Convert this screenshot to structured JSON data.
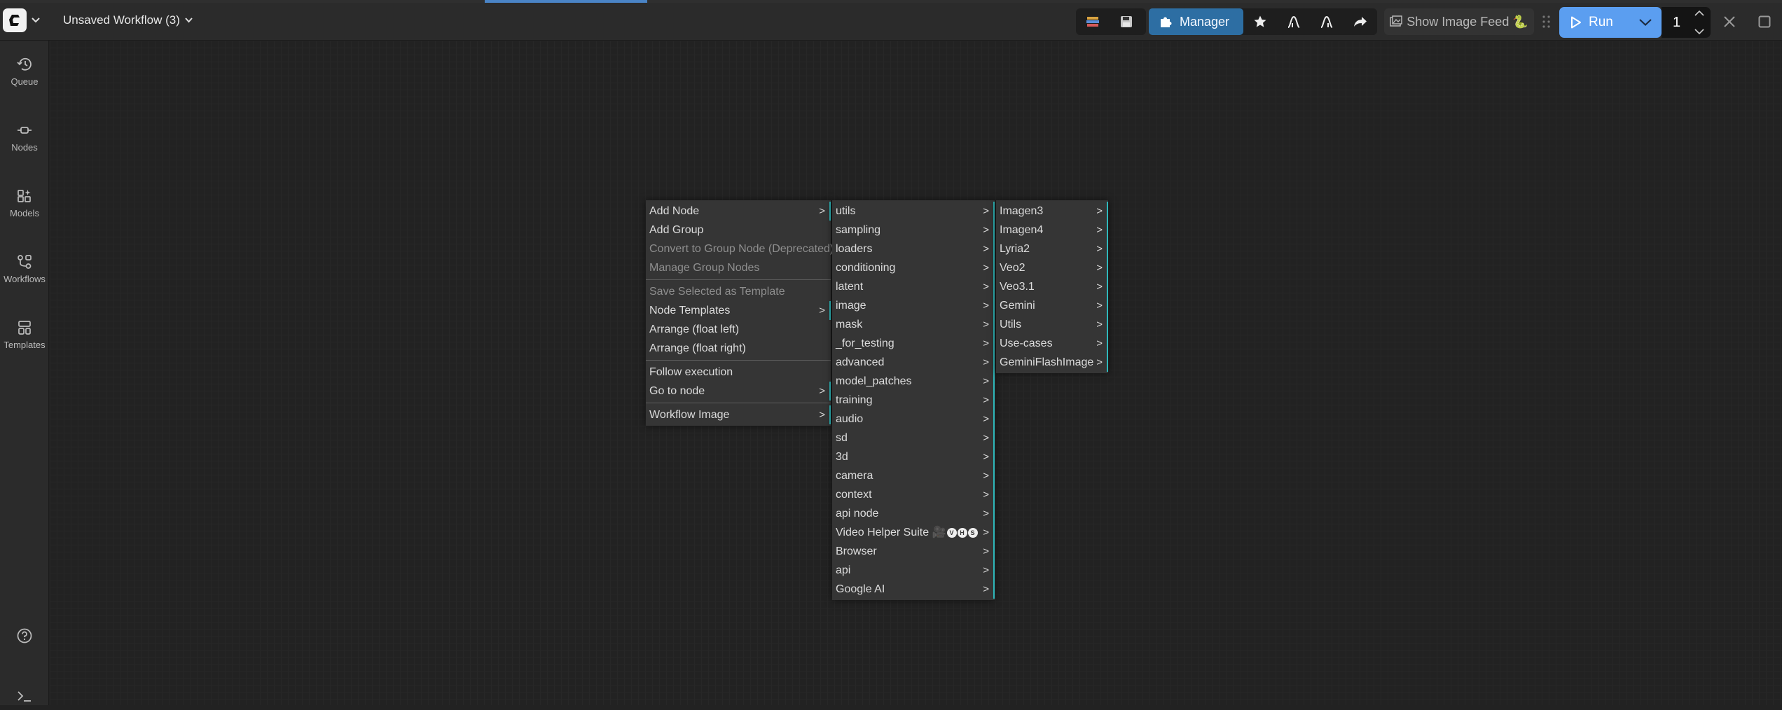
{
  "topbar": {
    "workflow_title": "Unsaved Workflow (3)",
    "manager_label": "Manager",
    "image_feed_label": "Show Image Feed 🐍",
    "run_label": "Run",
    "batch_count": "1"
  },
  "sidebar": {
    "items": [
      {
        "label": "Queue",
        "icon": "history-icon"
      },
      {
        "label": "Nodes",
        "icon": "node-icon"
      },
      {
        "label": "Models",
        "icon": "models-icon"
      },
      {
        "label": "Workflows",
        "icon": "workflows-icon"
      },
      {
        "label": "Templates",
        "icon": "templates-icon"
      }
    ],
    "bottom": [
      {
        "icon": "help-icon"
      },
      {
        "icon": "terminal-icon"
      }
    ]
  },
  "context_menu": {
    "items": [
      {
        "label": "Add Node",
        "submenu": true
      },
      {
        "label": "Add Group"
      },
      {
        "label": "Convert to Group Node (Deprecated)",
        "disabled": true
      },
      {
        "label": "Manage Group Nodes",
        "disabled": true
      },
      {
        "label": "Save Selected as Template",
        "disabled": true
      },
      {
        "label": "Node Templates",
        "submenu": true
      },
      {
        "label": "Arrange (float left)"
      },
      {
        "label": "Arrange (float right)"
      },
      {
        "label": "Follow execution"
      },
      {
        "label": "Go to node",
        "submenu": true
      },
      {
        "label": "Workflow Image",
        "submenu": true
      }
    ]
  },
  "add_node_menu": {
    "items": [
      "utils",
      "sampling",
      "loaders",
      "conditioning",
      "latent",
      "image",
      "mask",
      "_for_testing",
      "advanced",
      "model_patches",
      "training",
      "audio",
      "sd",
      "3d",
      "camera",
      "context",
      "api node",
      "Video Helper Suite 🎥",
      "Browser",
      "api",
      "Google AI"
    ],
    "vhs_badges": [
      "V",
      "H",
      "S"
    ]
  },
  "google_ai_menu": {
    "items": [
      "Imagen3",
      "Imagen4",
      "Lyria2",
      "Veo2",
      "Veo3.1",
      "Gemini",
      "Utils",
      "Use-cases",
      "GeminiFlashImage"
    ]
  },
  "submenu_arrow": ">",
  "colors": {
    "accent_blue": "#2d6ea3",
    "run_blue": "#5b9ef0",
    "submenu_marker": "#2fb8bb",
    "menu_bg": "#353535",
    "canvas_bg": "#222222"
  }
}
